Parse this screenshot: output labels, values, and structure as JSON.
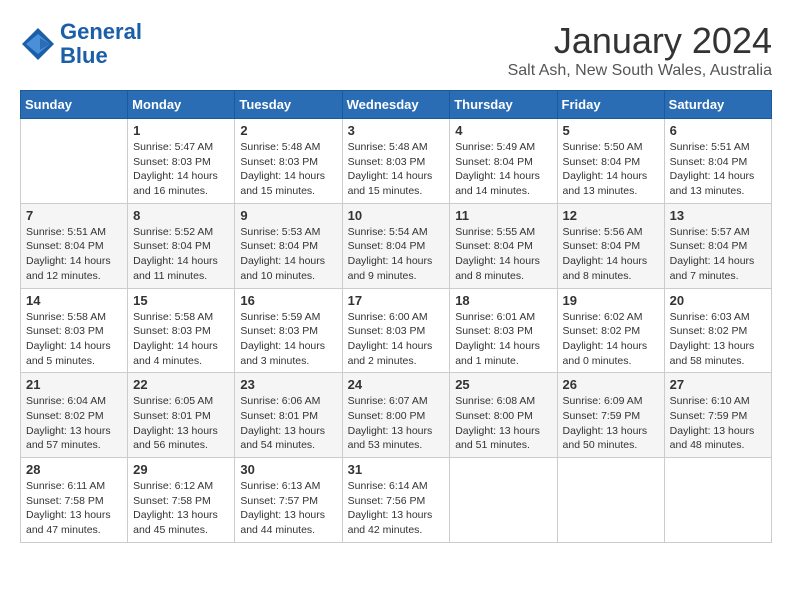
{
  "header": {
    "logo_line1": "General",
    "logo_line2": "Blue",
    "title": "January 2024",
    "location": "Salt Ash, New South Wales, Australia"
  },
  "days_of_week": [
    "Sunday",
    "Monday",
    "Tuesday",
    "Wednesday",
    "Thursday",
    "Friday",
    "Saturday"
  ],
  "weeks": [
    [
      {
        "day": "",
        "info": ""
      },
      {
        "day": "1",
        "info": "Sunrise: 5:47 AM\nSunset: 8:03 PM\nDaylight: 14 hours\nand 16 minutes."
      },
      {
        "day": "2",
        "info": "Sunrise: 5:48 AM\nSunset: 8:03 PM\nDaylight: 14 hours\nand 15 minutes."
      },
      {
        "day": "3",
        "info": "Sunrise: 5:48 AM\nSunset: 8:03 PM\nDaylight: 14 hours\nand 15 minutes."
      },
      {
        "day": "4",
        "info": "Sunrise: 5:49 AM\nSunset: 8:04 PM\nDaylight: 14 hours\nand 14 minutes."
      },
      {
        "day": "5",
        "info": "Sunrise: 5:50 AM\nSunset: 8:04 PM\nDaylight: 14 hours\nand 13 minutes."
      },
      {
        "day": "6",
        "info": "Sunrise: 5:51 AM\nSunset: 8:04 PM\nDaylight: 14 hours\nand 13 minutes."
      }
    ],
    [
      {
        "day": "7",
        "info": "Sunrise: 5:51 AM\nSunset: 8:04 PM\nDaylight: 14 hours\nand 12 minutes."
      },
      {
        "day": "8",
        "info": "Sunrise: 5:52 AM\nSunset: 8:04 PM\nDaylight: 14 hours\nand 11 minutes."
      },
      {
        "day": "9",
        "info": "Sunrise: 5:53 AM\nSunset: 8:04 PM\nDaylight: 14 hours\nand 10 minutes."
      },
      {
        "day": "10",
        "info": "Sunrise: 5:54 AM\nSunset: 8:04 PM\nDaylight: 14 hours\nand 9 minutes."
      },
      {
        "day": "11",
        "info": "Sunrise: 5:55 AM\nSunset: 8:04 PM\nDaylight: 14 hours\nand 8 minutes."
      },
      {
        "day": "12",
        "info": "Sunrise: 5:56 AM\nSunset: 8:04 PM\nDaylight: 14 hours\nand 8 minutes."
      },
      {
        "day": "13",
        "info": "Sunrise: 5:57 AM\nSunset: 8:04 PM\nDaylight: 14 hours\nand 7 minutes."
      }
    ],
    [
      {
        "day": "14",
        "info": "Sunrise: 5:58 AM\nSunset: 8:03 PM\nDaylight: 14 hours\nand 5 minutes."
      },
      {
        "day": "15",
        "info": "Sunrise: 5:58 AM\nSunset: 8:03 PM\nDaylight: 14 hours\nand 4 minutes."
      },
      {
        "day": "16",
        "info": "Sunrise: 5:59 AM\nSunset: 8:03 PM\nDaylight: 14 hours\nand 3 minutes."
      },
      {
        "day": "17",
        "info": "Sunrise: 6:00 AM\nSunset: 8:03 PM\nDaylight: 14 hours\nand 2 minutes."
      },
      {
        "day": "18",
        "info": "Sunrise: 6:01 AM\nSunset: 8:03 PM\nDaylight: 14 hours\nand 1 minute."
      },
      {
        "day": "19",
        "info": "Sunrise: 6:02 AM\nSunset: 8:02 PM\nDaylight: 14 hours\nand 0 minutes."
      },
      {
        "day": "20",
        "info": "Sunrise: 6:03 AM\nSunset: 8:02 PM\nDaylight: 13 hours\nand 58 minutes."
      }
    ],
    [
      {
        "day": "21",
        "info": "Sunrise: 6:04 AM\nSunset: 8:02 PM\nDaylight: 13 hours\nand 57 minutes."
      },
      {
        "day": "22",
        "info": "Sunrise: 6:05 AM\nSunset: 8:01 PM\nDaylight: 13 hours\nand 56 minutes."
      },
      {
        "day": "23",
        "info": "Sunrise: 6:06 AM\nSunset: 8:01 PM\nDaylight: 13 hours\nand 54 minutes."
      },
      {
        "day": "24",
        "info": "Sunrise: 6:07 AM\nSunset: 8:00 PM\nDaylight: 13 hours\nand 53 minutes."
      },
      {
        "day": "25",
        "info": "Sunrise: 6:08 AM\nSunset: 8:00 PM\nDaylight: 13 hours\nand 51 minutes."
      },
      {
        "day": "26",
        "info": "Sunrise: 6:09 AM\nSunset: 7:59 PM\nDaylight: 13 hours\nand 50 minutes."
      },
      {
        "day": "27",
        "info": "Sunrise: 6:10 AM\nSunset: 7:59 PM\nDaylight: 13 hours\nand 48 minutes."
      }
    ],
    [
      {
        "day": "28",
        "info": "Sunrise: 6:11 AM\nSunset: 7:58 PM\nDaylight: 13 hours\nand 47 minutes."
      },
      {
        "day": "29",
        "info": "Sunrise: 6:12 AM\nSunset: 7:58 PM\nDaylight: 13 hours\nand 45 minutes."
      },
      {
        "day": "30",
        "info": "Sunrise: 6:13 AM\nSunset: 7:57 PM\nDaylight: 13 hours\nand 44 minutes."
      },
      {
        "day": "31",
        "info": "Sunrise: 6:14 AM\nSunset: 7:56 PM\nDaylight: 13 hours\nand 42 minutes."
      },
      {
        "day": "",
        "info": ""
      },
      {
        "day": "",
        "info": ""
      },
      {
        "day": "",
        "info": ""
      }
    ]
  ]
}
